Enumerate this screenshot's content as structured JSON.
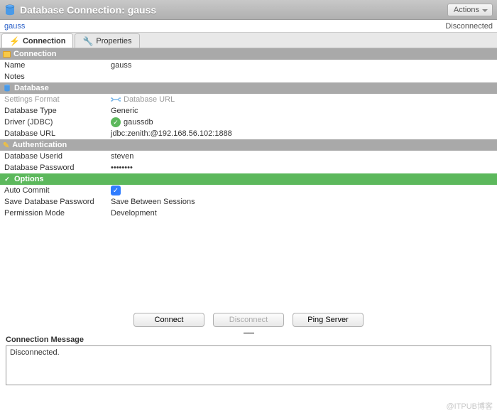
{
  "titlebar": {
    "title": "Database Connection: gauss"
  },
  "actions": {
    "label": "Actions"
  },
  "breadcrumb": {
    "name": "gauss"
  },
  "status": {
    "text": "Disconnected"
  },
  "tabs": {
    "connection": "Connection",
    "properties": "Properties"
  },
  "sections": {
    "connection": "Connection",
    "database": "Database",
    "authentication": "Authentication",
    "options": "Options"
  },
  "fields": {
    "name": {
      "label": "Name",
      "value": "gauss"
    },
    "notes": {
      "label": "Notes",
      "value": ""
    },
    "settings_format": {
      "label": "Settings Format",
      "value": "Database URL"
    },
    "database_type": {
      "label": "Database Type",
      "value": "Generic"
    },
    "driver": {
      "label": "Driver (JDBC)",
      "value": "gaussdb"
    },
    "database_url": {
      "label": "Database URL",
      "value": "jdbc:zenith:@192.168.56.102:1888"
    },
    "database_userid": {
      "label": "Database Userid",
      "value": "steven"
    },
    "database_password": {
      "label": "Database Password",
      "value": "••••••••"
    },
    "auto_commit": {
      "label": "Auto Commit",
      "checked": true
    },
    "save_password": {
      "label": "Save Database Password",
      "value": "Save Between Sessions"
    },
    "permission_mode": {
      "label": "Permission Mode",
      "value": "Development"
    }
  },
  "buttons": {
    "connect": "Connect",
    "disconnect": "Disconnect",
    "ping": "Ping Server"
  },
  "message": {
    "label": "Connection Message",
    "text": "Disconnected."
  },
  "watermark": "@ITPUB博客"
}
